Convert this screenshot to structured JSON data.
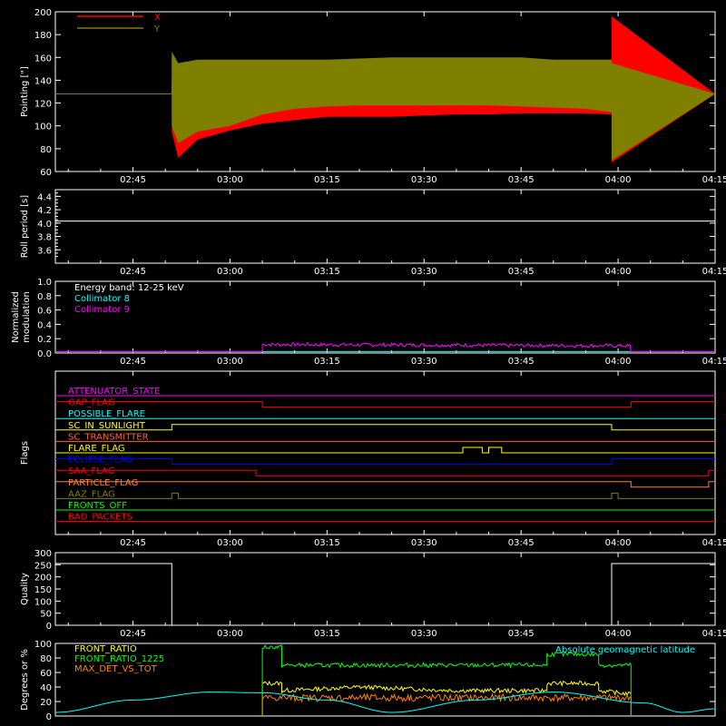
{
  "chart_data": [
    {
      "type": "line",
      "ylabel": "Pointing [\"]",
      "xlim": [
        "02:33",
        "04:15"
      ],
      "ylim": [
        60,
        200
      ],
      "yticks": [
        60,
        80,
        100,
        120,
        140,
        160,
        180,
        200
      ],
      "xticks": [
        "02:45",
        "03:00",
        "03:15",
        "03:30",
        "03:45",
        "04:00",
        "04:15"
      ],
      "legend": [
        {
          "label": "X",
          "color": "#ff0000"
        },
        {
          "label": "Y",
          "color": "#808000"
        }
      ],
      "series": [
        {
          "name": "X",
          "color": "#ff0000",
          "x": [
            "02:33",
            "02:51",
            "02:51",
            "02:52",
            "02:55",
            "03:00",
            "03:05",
            "03:10",
            "03:15",
            "03:20",
            "03:25",
            "03:30",
            "03:35",
            "03:40",
            "03:45",
            "03:50",
            "03:55",
            "03:59",
            "03:59",
            "04:15"
          ],
          "upper": [
            128,
            128,
            160,
            150,
            150,
            147,
            148,
            148,
            149,
            150,
            152,
            153,
            154,
            155,
            155,
            156,
            156,
            158,
            196,
            128
          ],
          "lower": [
            128,
            128,
            95,
            72,
            88,
            96,
            102,
            105,
            108,
            108,
            108,
            109,
            110,
            110,
            111,
            111,
            111,
            110,
            68,
            128
          ]
        },
        {
          "name": "Y",
          "color": "#808000",
          "x": [
            "02:33",
            "02:51",
            "02:51",
            "02:52",
            "02:55",
            "03:00",
            "03:05",
            "03:10",
            "03:15",
            "03:20",
            "03:25",
            "03:30",
            "03:35",
            "03:40",
            "03:45",
            "03:50",
            "03:55",
            "03:59",
            "03:59",
            "04:15"
          ],
          "upper": [
            128,
            128,
            165,
            155,
            158,
            158,
            158,
            158,
            158,
            159,
            160,
            160,
            160,
            160,
            160,
            158,
            158,
            158,
            155,
            128
          ],
          "lower": [
            128,
            128,
            100,
            85,
            95,
            100,
            110,
            115,
            117,
            118,
            118,
            118,
            118,
            118,
            117,
            116,
            115,
            112,
            70,
            128
          ]
        }
      ]
    },
    {
      "type": "line",
      "ylabel": "Roll period [s]",
      "ylim": [
        3.4,
        4.5
      ],
      "yticks": [
        "3.6",
        "3.8",
        "4.0",
        "4.2",
        "4.4"
      ],
      "xticks": [
        "02:45",
        "03:00",
        "03:15",
        "03:30",
        "03:45",
        "04:00",
        "04:15"
      ],
      "series": [
        {
          "color": "#ffffff",
          "x": [
            "02:33",
            "04:15"
          ],
          "y": [
            4.03,
            4.03
          ]
        }
      ]
    },
    {
      "type": "line",
      "ylabel": "Normalized modulation",
      "ylim": [
        0.0,
        1.0
      ],
      "yticks": [
        "0.0",
        "0.2",
        "0.4",
        "0.6",
        "0.8",
        "1.0"
      ],
      "xticks": [
        "02:45",
        "03:00",
        "03:15",
        "03:30",
        "03:45",
        "04:00",
        "04:15"
      ],
      "legend": [
        {
          "label": "Energy band: 12-25 keV",
          "color": "#ffffff"
        },
        {
          "label": "Collimator 8",
          "color": "#00ffff"
        },
        {
          "label": "Collimator 9",
          "color": "#ff00ff"
        }
      ],
      "series": [
        {
          "name": "Collimator 8",
          "color": "#00ffff",
          "x": [
            "02:33",
            "04:15"
          ],
          "y": [
            0.02,
            0.02
          ]
        },
        {
          "name": "Collimator 9",
          "color": "#ff00ff",
          "x": [
            "02:33",
            "03:05",
            "03:05",
            "04:02",
            "04:02",
            "04:15"
          ],
          "y": [
            0.02,
            0.02,
            0.12,
            0.1,
            0.02,
            0.02
          ]
        }
      ]
    },
    {
      "type": "line",
      "ylabel": "Flags",
      "xticks": [
        "02:45",
        "03:00",
        "03:15",
        "03:30",
        "03:45",
        "04:00",
        "04:15"
      ],
      "flags": [
        {
          "label": "ATTENUATOR_STATE",
          "color": "#ff00ff",
          "steps": [
            [
              "02:33",
              0
            ],
            [
              "04:15",
              0
            ]
          ]
        },
        {
          "label": "GAP_FLAG",
          "color": "#ff0000",
          "steps": [
            [
              "02:33",
              1
            ],
            [
              "03:05",
              0
            ],
            [
              "04:02",
              1
            ],
            [
              "04:15",
              1
            ]
          ]
        },
        {
          "label": "POSSIBLE_FLARE",
          "color": "#00ffff",
          "steps": [
            [
              "02:33",
              0
            ],
            [
              "04:15",
              0
            ]
          ]
        },
        {
          "label": "SC_IN_SUNLIGHT",
          "color": "#ffff00",
          "steps": [
            [
              "02:33",
              0
            ],
            [
              "02:51",
              1
            ],
            [
              "03:59",
              0
            ],
            [
              "04:15",
              0
            ]
          ]
        },
        {
          "label": "SC_TRANSMITTER",
          "color": "#ff6040",
          "steps": [
            [
              "02:33",
              0
            ],
            [
              "04:15",
              0
            ]
          ]
        },
        {
          "label": "FLARE_FLAG",
          "color": "#ffff00",
          "steps": [
            [
              "02:33",
              0
            ],
            [
              "03:36",
              1
            ],
            [
              "03:39",
              0
            ],
            [
              "03:40",
              1
            ],
            [
              "03:42",
              0
            ],
            [
              "04:15",
              0
            ]
          ]
        },
        {
          "label": "ECLIPSE_FLAG",
          "color": "#0000ff",
          "steps": [
            [
              "02:33",
              1
            ],
            [
              "02:51",
              0
            ],
            [
              "03:59",
              1
            ],
            [
              "04:15",
              1
            ]
          ]
        },
        {
          "label": "SAA_FLAG",
          "color": "#ff0000",
          "steps": [
            [
              "02:33",
              1
            ],
            [
              "03:04",
              0
            ],
            [
              "04:14",
              1
            ],
            [
              "04:15",
              1
            ]
          ]
        },
        {
          "label": "PARTICLE_FLAG",
          "color": "#ff8040",
          "steps": [
            [
              "02:33",
              1
            ],
            [
              "04:02",
              0
            ],
            [
              "04:14",
              1
            ],
            [
              "04:15",
              1
            ]
          ]
        },
        {
          "label": "AAZ_FLAG",
          "color": "#808000",
          "steps": [
            [
              "02:33",
              0
            ],
            [
              "02:51",
              1
            ],
            [
              "02:52",
              0
            ],
            [
              "03:59",
              1
            ],
            [
              "04:00",
              0
            ],
            [
              "04:15",
              0
            ]
          ]
        },
        {
          "label": "FRONTS_OFF",
          "color": "#00ff00",
          "steps": [
            [
              "02:33",
              0
            ],
            [
              "04:15",
              0
            ]
          ]
        },
        {
          "label": "BAD_PACKETS",
          "color": "#ff0000",
          "steps": [
            [
              "02:33",
              0
            ],
            [
              "04:15",
              0
            ]
          ]
        }
      ]
    },
    {
      "type": "line",
      "ylabel": "Quality",
      "ylim": [
        0,
        300
      ],
      "yticks": [
        "0",
        "50",
        "100",
        "150",
        "200",
        "250",
        "300"
      ],
      "xticks": [
        "02:45",
        "03:00",
        "03:15",
        "03:30",
        "03:45",
        "04:00",
        "04:15"
      ],
      "series": [
        {
          "color": "#ffffff",
          "x": [
            "02:33",
            "02:51",
            "02:51",
            "03:59",
            "03:59",
            "04:15"
          ],
          "y": [
            255,
            255,
            0,
            0,
            255,
            255
          ]
        }
      ]
    },
    {
      "type": "line",
      "ylabel": "Degrees or %",
      "ylim": [
        0,
        100
      ],
      "yticks": [
        "0",
        "20",
        "40",
        "60",
        "80",
        "100"
      ],
      "legend": [
        {
          "label": "FRONT_RATIO",
          "color": "#ffff00"
        },
        {
          "label": "FRONT_RATIO_1225",
          "color": "#00ff00"
        },
        {
          "label": "MAX_DET_VS_TOT",
          "color": "#ff8000"
        },
        {
          "label": "Absolute geomagnetic latitude",
          "color": "#00ffff"
        }
      ],
      "series": [
        {
          "name": "FRONT_RATIO",
          "color": "#ffff00",
          "x": [
            "03:05",
            "03:05",
            "03:08",
            "03:08",
            "03:20",
            "03:35",
            "03:49",
            "03:49",
            "03:57",
            "03:57",
            "04:02"
          ],
          "y": [
            0,
            45,
            45,
            35,
            40,
            35,
            35,
            45,
            45,
            35,
            30
          ]
        },
        {
          "name": "FRONT_RATIO_1225",
          "color": "#00ff00",
          "x": [
            "03:05",
            "03:05",
            "03:08",
            "03:08",
            "03:49",
            "03:49",
            "03:57",
            "03:57",
            "04:02",
            "04:02"
          ],
          "y": [
            0,
            95,
            95,
            70,
            70,
            85,
            85,
            70,
            70,
            0
          ]
        },
        {
          "name": "MAX_DET_VS_TOT",
          "color": "#ff8000",
          "x": [
            "03:05",
            "03:05",
            "04:02",
            "04:02"
          ],
          "y": [
            0,
            25,
            25,
            0
          ]
        },
        {
          "name": "Absolute geomagnetic latitude",
          "color": "#00ffff",
          "x": [
            "02:33",
            "02:45",
            "02:57",
            "03:05",
            "03:15",
            "03:25",
            "03:38",
            "03:50",
            "04:04",
            "04:10",
            "04:15"
          ],
          "y": [
            5,
            22,
            33,
            32,
            22,
            5,
            22,
            33,
            18,
            5,
            10
          ]
        }
      ]
    }
  ]
}
